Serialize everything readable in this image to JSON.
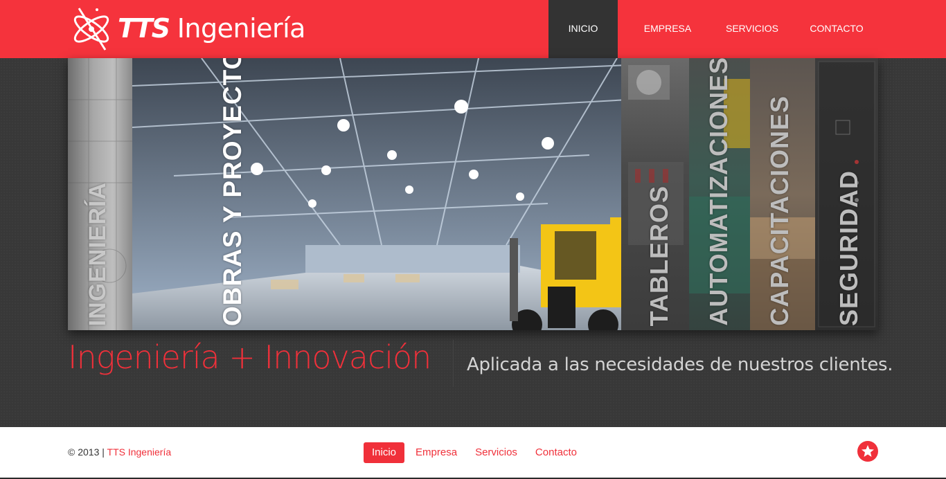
{
  "header": {
    "logo_prefix": "TTS",
    "logo_suffix": "Ingeniería",
    "nav": [
      {
        "label": "INICIO",
        "active": true
      },
      {
        "label": "EMPRESA",
        "active": false
      },
      {
        "label": "SERVICIOS",
        "active": false
      },
      {
        "label": "CONTACTO",
        "active": false
      }
    ]
  },
  "gallery": {
    "panels": [
      {
        "label": "INGENIERÍA"
      },
      {
        "label": "OBRAS Y PROYECTOS"
      },
      {
        "label": "TABLEROS"
      },
      {
        "label": "AUTOMATIZACIONES"
      },
      {
        "label": "CAPACITACIONES"
      },
      {
        "label": "SEGURIDAD"
      }
    ]
  },
  "tagline": {
    "left": "Ingeniería + Innovación",
    "right": "Aplicada a las necesidades de nuestros clientes."
  },
  "footer": {
    "copyright": "© 2013 | ",
    "brand": "TTS Ingeniería",
    "nav": [
      {
        "label": "Inicio",
        "active": true
      },
      {
        "label": "Empresa",
        "active": false
      },
      {
        "label": "Servicios",
        "active": false
      },
      {
        "label": "Contacto",
        "active": false
      }
    ],
    "social_icon": "star-logo-icon"
  },
  "colors": {
    "brand_red": "#f5333c",
    "dark_band": "#383838",
    "active_nav": "#333333"
  }
}
